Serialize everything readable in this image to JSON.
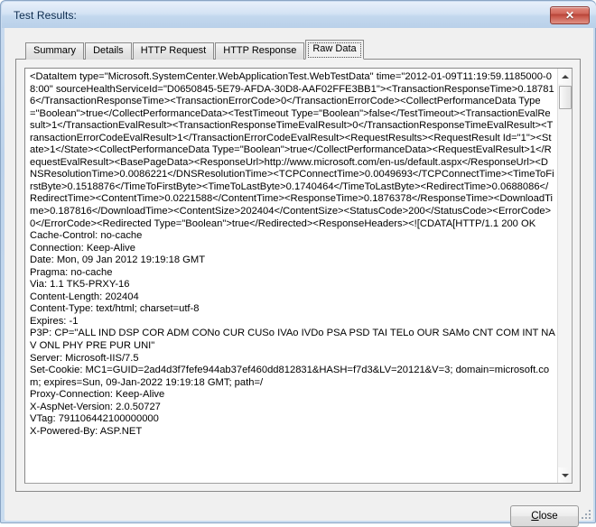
{
  "window": {
    "title": "Test Results:",
    "close_icon": "close-x-icon",
    "close_glyph": "✕"
  },
  "tabs": [
    {
      "label": "Summary",
      "selected": false
    },
    {
      "label": "Details",
      "selected": false
    },
    {
      "label": "HTTP Request",
      "selected": false
    },
    {
      "label": "HTTP Response",
      "selected": false
    },
    {
      "label": "Raw Data",
      "selected": true
    }
  ],
  "raw_data": {
    "text": "<DataItem type=\"Microsoft.SystemCenter.WebApplicationTest.WebTestData\" time=\"2012-01-09T11:19:59.1185000-08:00\" sourceHealthServiceId=\"D0650845-5E79-AFDA-30D8-AAF02FFE3BB1\"><TransactionResponseTime>0.187816</TransactionResponseTime><TransactionErrorCode>0</TransactionErrorCode><CollectPerformanceData Type=\"Boolean\">true</CollectPerformanceData><TestTimeout Type=\"Boolean\">false</TestTimeout><TransactionEvalResult>1</TransactionEvalResult><TransactionResponseTimeEvalResult>0</TransactionResponseTimeEvalResult><TransactionErrorCodeEvalResult>1</TransactionErrorCodeEvalResult><RequestResults><RequestResult Id=\"1\"><State>1</State><CollectPerformanceData Type=\"Boolean\">true</CollectPerformanceData><RequestEvalResult>1</RequestEvalResult><BasePageData><ResponseUrl>http://www.microsoft.com/en-us/default.aspx</ResponseUrl><DNSResolutionTime>0.0086221</DNSResolutionTime><TCPConnectTime>0.0049693</TCPConnectTime><TimeToFirstByte>0.1518876</TimeToFirstByte><TimeToLastByte>0.1740464</TimeToLastByte><RedirectTime>0.0688086</RedirectTime><ContentTime>0.0221588</ContentTime><ResponseTime>0.1876378</ResponseTime><DownloadTime>0.187816</DownloadTime><ContentSize>202404</ContentSize><StatusCode>200</StatusCode><ErrorCode>0</ErrorCode><Redirected Type=\"Boolean\">true</Redirected><ResponseHeaders><![CDATA[HTTP/1.1 200 OK\nCache-Control: no-cache\nConnection: Keep-Alive\nDate: Mon, 09 Jan 2012 19:19:18 GMT\nPragma: no-cache\nVia: 1.1 TK5-PRXY-16\nContent-Length: 202404\nContent-Type: text/html; charset=utf-8\nExpires: -1\nP3P: CP=\"ALL IND DSP COR ADM CONo CUR CUSo IVAo IVDo PSA PSD TAI TELo OUR SAMo CNT COM INT NAV ONL PHY PRE PUR UNI\"\nServer: Microsoft-IIS/7.5\nSet-Cookie: MC1=GUID=2ad4d3f7fefe944ab37ef460dd812831&HASH=f7d3&LV=20121&V=3; domain=microsoft.com; expires=Sun, 09-Jan-2022 19:19:18 GMT; path=/\nProxy-Connection: Keep-Alive\nX-AspNet-Version: 2.0.50727\nVTag: 791106442100000000\nX-Powered-By: ASP.NET"
  },
  "scrollbar": {
    "up_icon": "scroll-up-arrow-icon",
    "down_icon": "scroll-down-arrow-icon"
  },
  "footer": {
    "close_label_accel": "C",
    "close_label_rest": "lose"
  }
}
